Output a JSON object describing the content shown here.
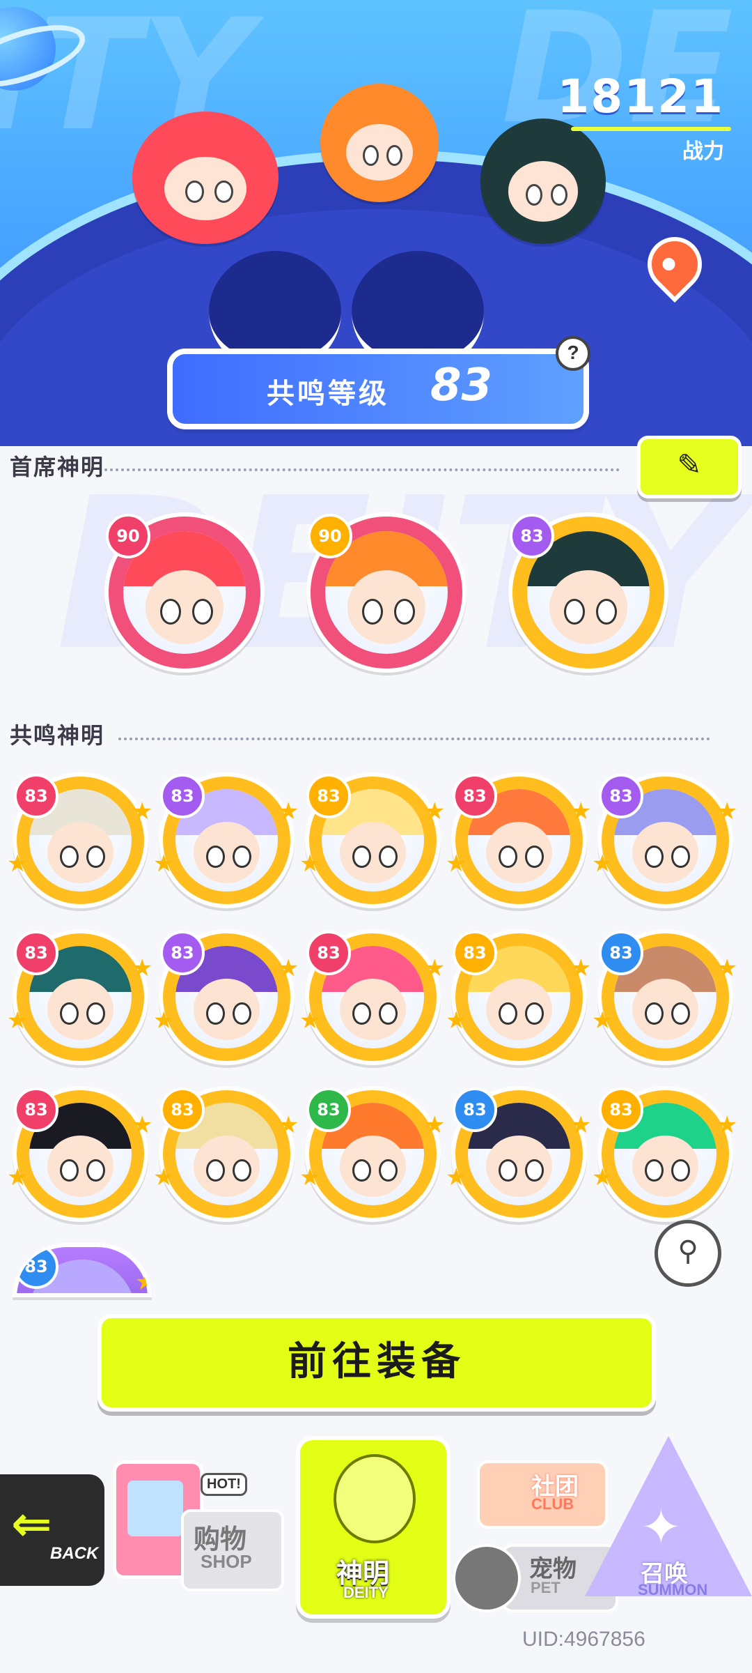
{
  "header": {
    "power_value": "18121",
    "power_label": "战力",
    "resonance_label": "共鸣等级",
    "resonance_level": "83",
    "help_glyph": "?"
  },
  "sections": {
    "chief_title": "首席神明",
    "resonance_title": "共鸣神明"
  },
  "chief_deities": [
    {
      "level": "90",
      "color": "#f0507a",
      "badge": "#f0406a",
      "hair": "#ff4a5a"
    },
    {
      "level": "90",
      "color": "#f0507a",
      "badge": "#ffb000",
      "hair": "#ff8a2c"
    },
    {
      "level": "83",
      "color": "#ffbe1e",
      "badge": "#a45cf0",
      "hair": "#1f3a3a"
    }
  ],
  "resonance_deities": [
    {
      "level": "83",
      "badge": "#f0406a",
      "hair": "#e8e4d8"
    },
    {
      "level": "83",
      "badge": "#a45cf0",
      "hair": "#c8b8ff"
    },
    {
      "level": "83",
      "badge": "#ffb000",
      "hair": "#ffe48a"
    },
    {
      "level": "83",
      "badge": "#f0406a",
      "hair": "#ff7a3c"
    },
    {
      "level": "83",
      "badge": "#a45cf0",
      "hair": "#9a9cf0"
    },
    {
      "level": "83",
      "badge": "#f0406a",
      "hair": "#1f6a6a"
    },
    {
      "level": "83",
      "badge": "#a45cf0",
      "hair": "#7a4acc"
    },
    {
      "level": "83",
      "badge": "#f0406a",
      "hair": "#ff5a8a"
    },
    {
      "level": "83",
      "badge": "#ffb000",
      "hair": "#ffd85a"
    },
    {
      "level": "83",
      "badge": "#2f8cf0",
      "hair": "#c98a6a"
    },
    {
      "level": "83",
      "badge": "#f0406a",
      "hair": "#1a1a22"
    },
    {
      "level": "83",
      "badge": "#ffb000",
      "hair": "#f0dfa0"
    },
    {
      "level": "83",
      "badge": "#2fb84a",
      "hair": "#ff7a2c"
    },
    {
      "level": "83",
      "badge": "#2f8cf0",
      "hair": "#2a2a4a"
    },
    {
      "level": "83",
      "badge": "#ffb000",
      "hair": "#1fd28a"
    },
    {
      "level": "83",
      "badge": "#2f8cf0",
      "hair": "#b8a8ff"
    }
  ],
  "actions": {
    "go_equip": "前往装备"
  },
  "nav": {
    "back_label": "BACK",
    "shop_cn": "购物",
    "shop_en": "SHOP",
    "hot_tag": "HOT!",
    "deity_cn": "神明",
    "deity_en": "DEITY",
    "club_cn": "社团",
    "club_en": "CLUB",
    "pet_cn": "宠物",
    "pet_en": "PET",
    "summon_cn": "召唤",
    "summon_en": "SUMMON"
  },
  "footer": {
    "uid": "UID:4967856"
  }
}
